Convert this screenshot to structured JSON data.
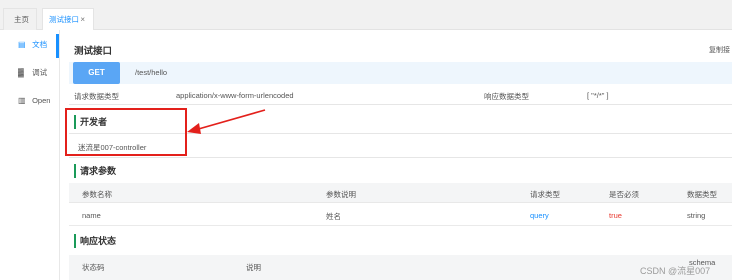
{
  "tabs": {
    "home": "主页",
    "active": "测试接口",
    "close": "×"
  },
  "sidebar": {
    "items": [
      {
        "label": "文档",
        "icon": "doc-icon"
      },
      {
        "label": "调试",
        "icon": "debug-icon"
      },
      {
        "label": "Open",
        "icon": "open-icon"
      }
    ]
  },
  "main": {
    "title": "测试接口",
    "copy": "复制接",
    "method": "GET",
    "path": "/test/hello",
    "request_type_label": "请求数据类型",
    "request_type_value": "application/x-www-form-urlencoded",
    "response_type_label": "响应数据类型",
    "response_type_value": "[ \"*/*\" ]"
  },
  "developer": {
    "title": "开发者",
    "value": "迷流星007-controller"
  },
  "params": {
    "title": "请求参数",
    "headers": [
      "参数名称",
      "参数说明",
      "请求类型",
      "是否必须",
      "数据类型"
    ],
    "rows": [
      {
        "name": "name",
        "desc": "姓名",
        "type": "query",
        "required": "true",
        "datatype": "string"
      }
    ]
  },
  "response": {
    "title": "响应状态",
    "headers": [
      "状态码",
      "说明",
      "schema"
    ]
  },
  "watermark": "CSDN @流星007",
  "colors": {
    "accent": "#1890ff",
    "get_button": "#5aa6f5",
    "section_bar": "#1a9a59",
    "annotation": "#e3201b"
  }
}
